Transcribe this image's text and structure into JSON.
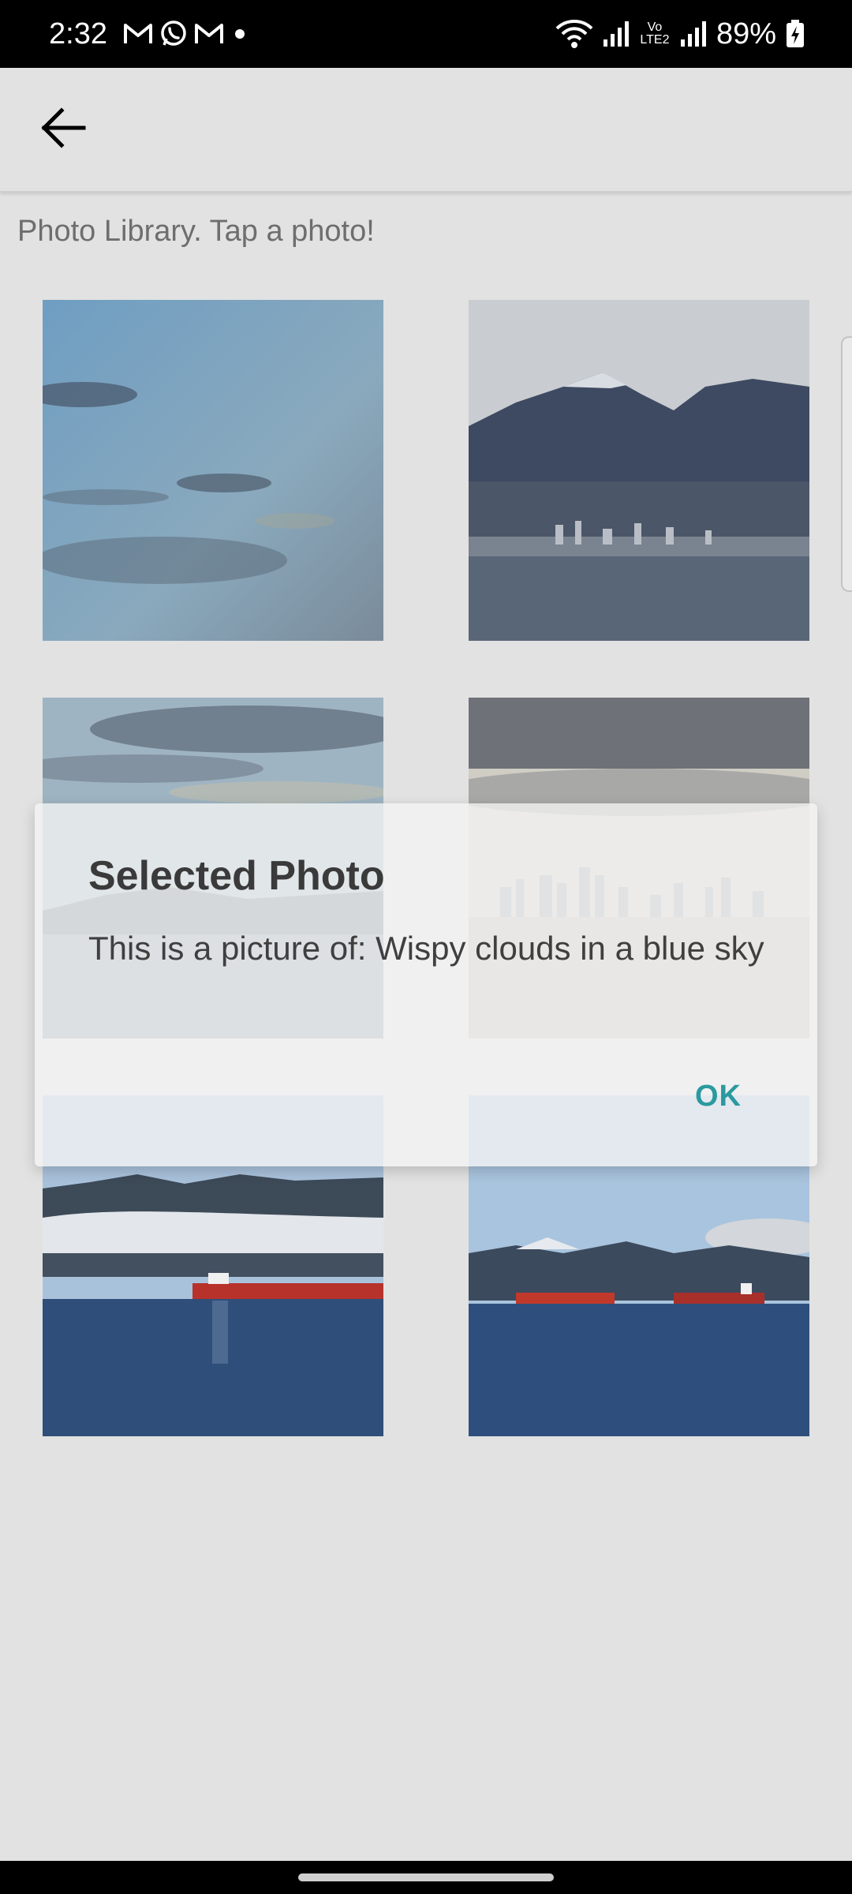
{
  "status_bar": {
    "time": "2:32",
    "notification_icons": [
      "gmail-icon",
      "whatsapp-icon",
      "gmail-icon",
      "dot-icon"
    ],
    "network_label": "Vo LTE2",
    "battery": "89%"
  },
  "app_bar": {
    "back_icon": "arrow-left-icon"
  },
  "hint_text": "Photo Library. Tap a photo!",
  "photos": [
    {
      "name": "photo-sky-clouds"
    },
    {
      "name": "photo-mountains-city"
    },
    {
      "name": "photo-clouds-water"
    },
    {
      "name": "photo-city-skyline"
    },
    {
      "name": "photo-red-ship"
    },
    {
      "name": "photo-two-ships"
    }
  ],
  "dialog": {
    "title": "Selected Photo",
    "message": "This is a picture of: Wispy clouds in a blue sky",
    "ok_label": "OK"
  },
  "colors": {
    "background": "#e2e2e2",
    "accent": "#2a9aa0"
  }
}
